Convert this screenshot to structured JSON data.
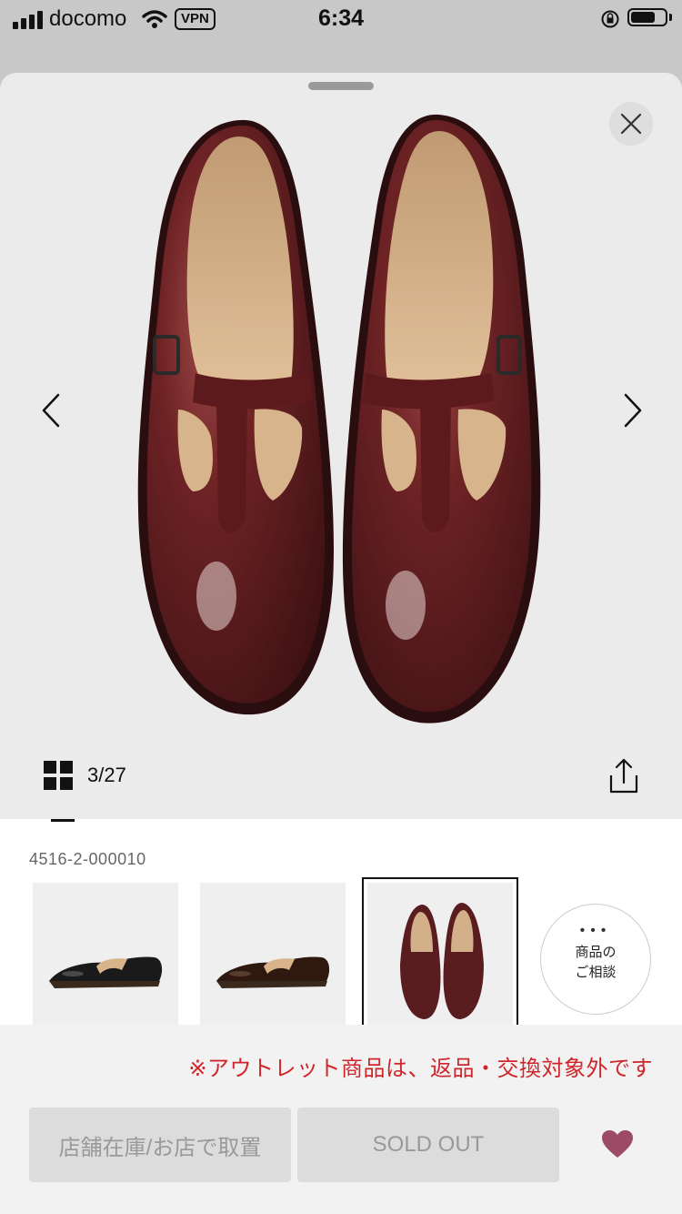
{
  "status_bar": {
    "carrier": "docomo",
    "vpn": "VPN",
    "time": "6:34"
  },
  "viewer": {
    "counter": "3/27",
    "product_code": "4516-2-000010"
  },
  "consult": {
    "dots": "•••",
    "line1": "商品の",
    "line2": "ご相談"
  },
  "footer": {
    "notice": "※アウトレット商品は、返品・交換対象外です",
    "store_button": "店舗在庫/お店で取置",
    "sold_out_button": "SOLD OUT"
  },
  "colors": {
    "notice_red": "#d0262b",
    "heart": "#9c4a66",
    "leather": "#5a1d1f"
  }
}
